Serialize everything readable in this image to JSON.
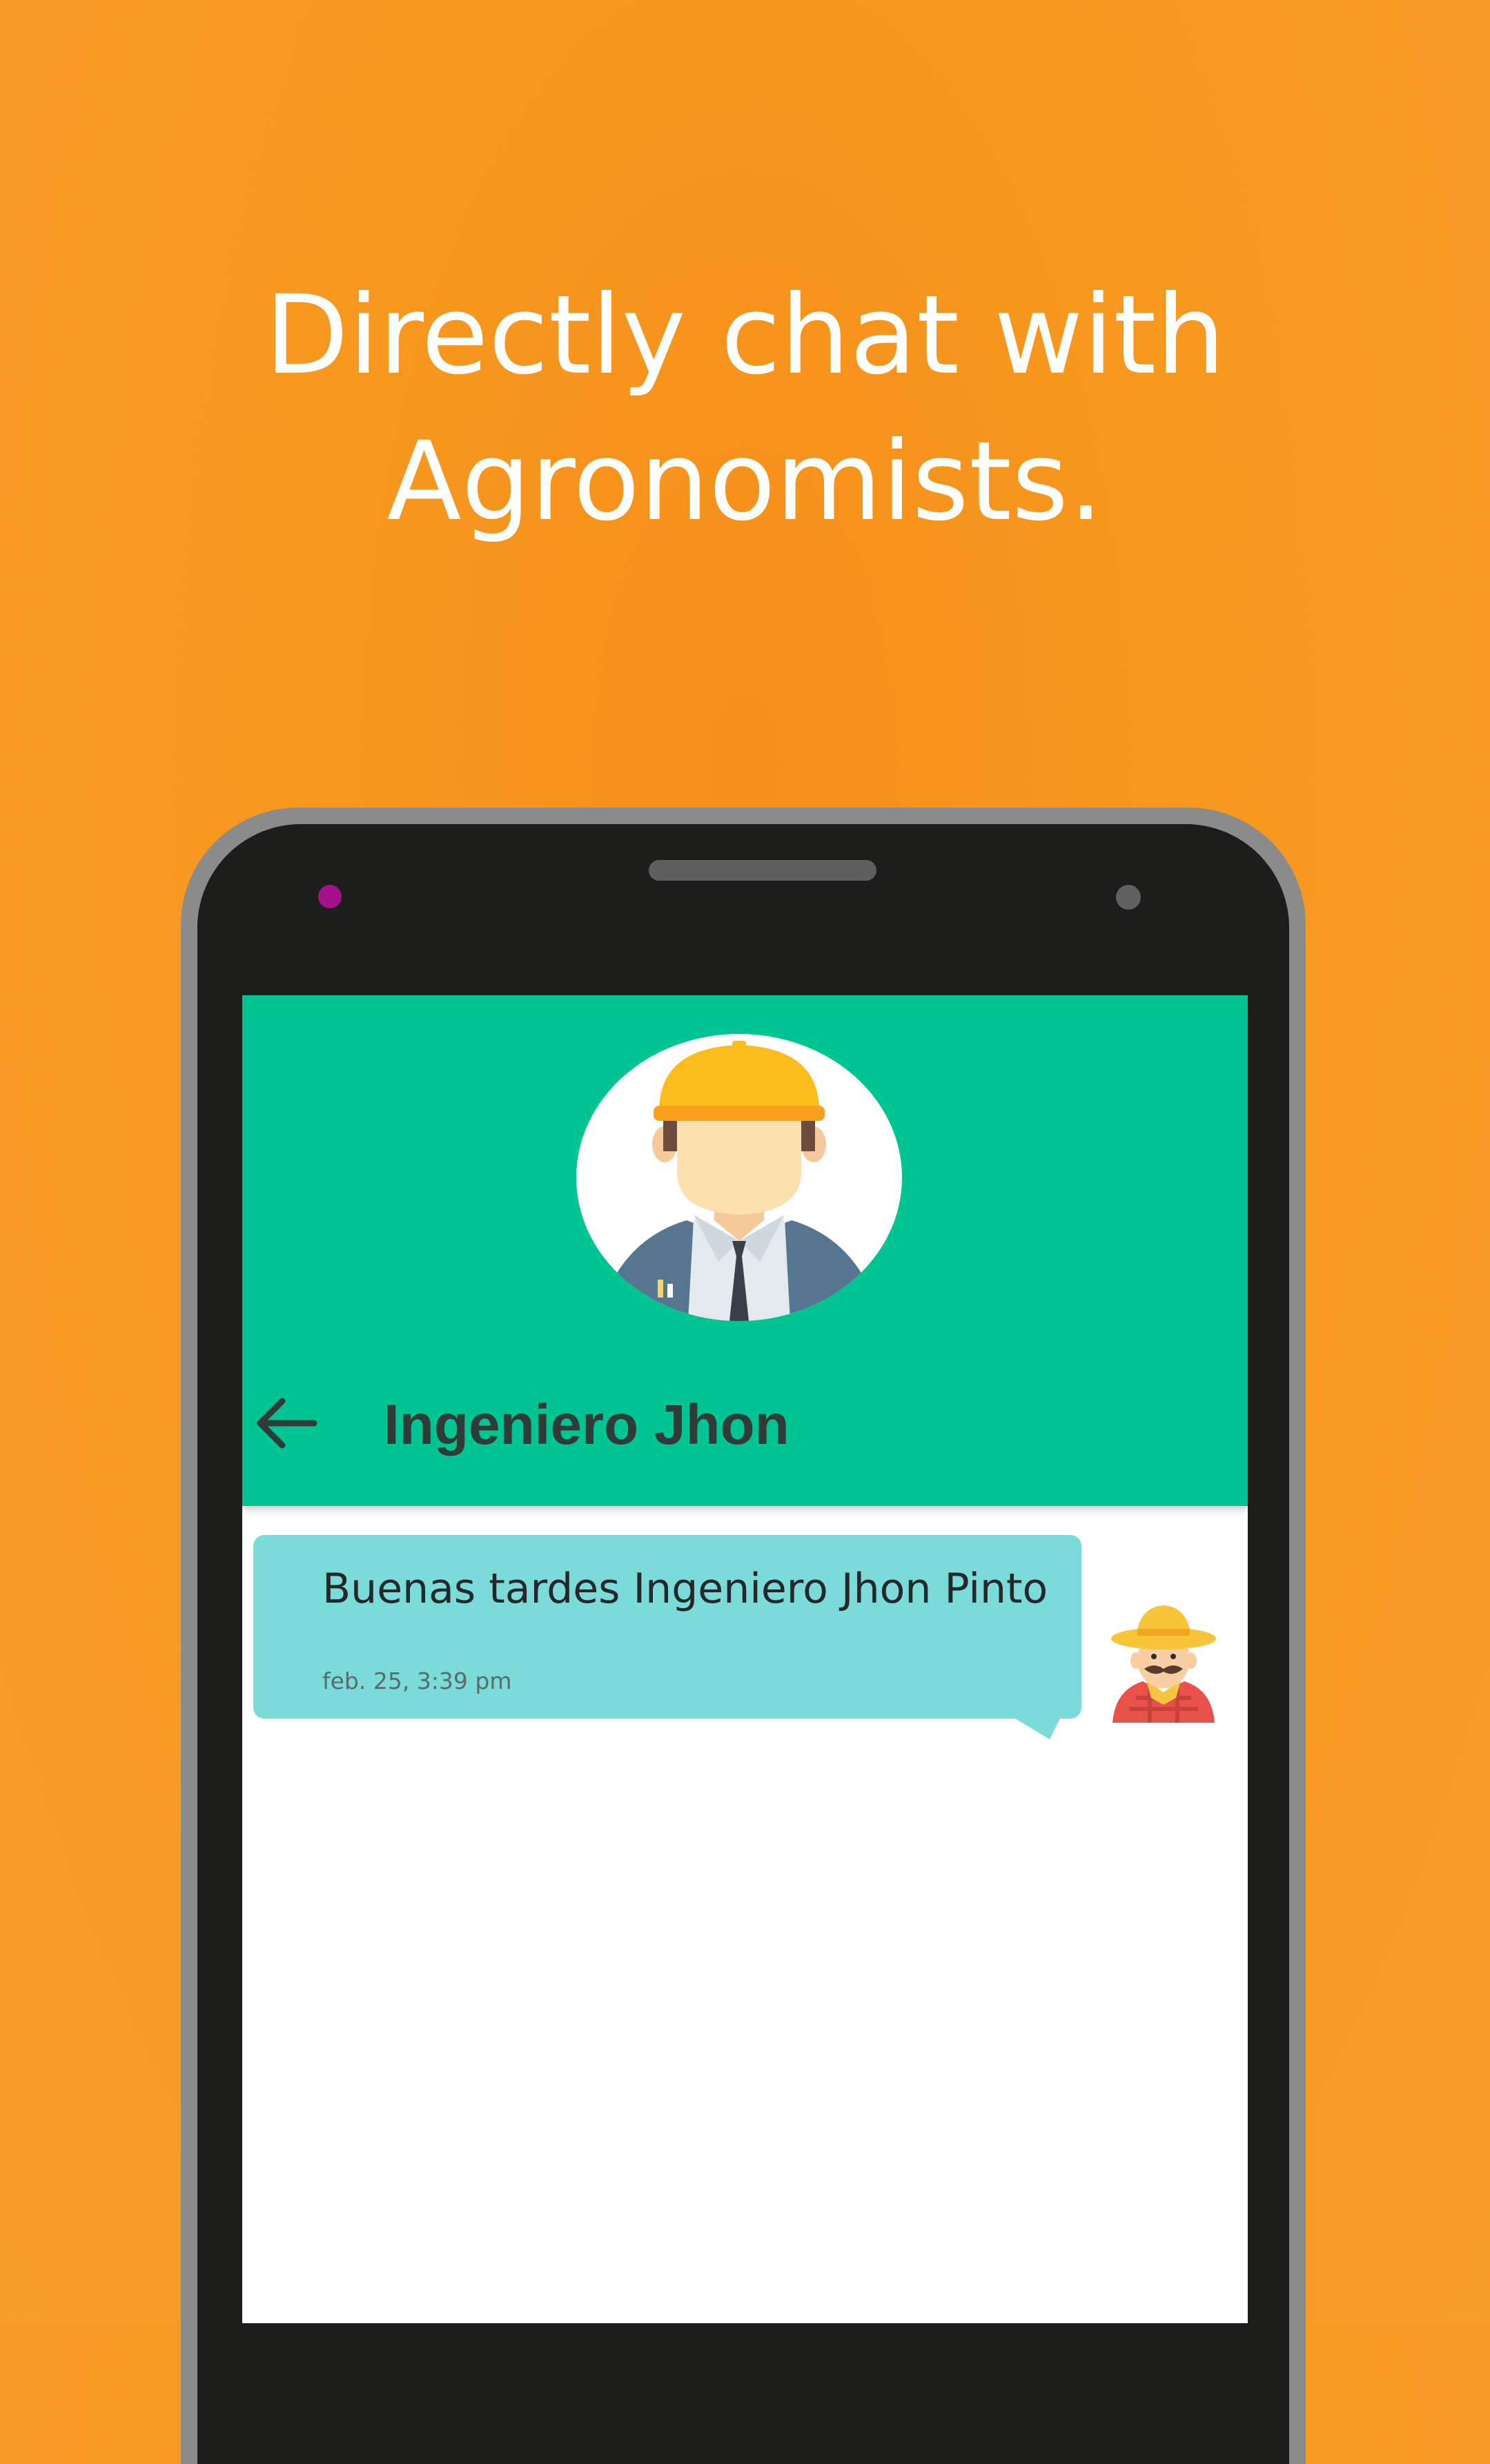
{
  "promo": {
    "headline_line1": "Directly chat with",
    "headline_line2": "Agronomists."
  },
  "colors": {
    "background": "#f89c2a",
    "header": "#00c593",
    "bubble": "#7adbd9",
    "phone_frame": "#1d1d1b"
  },
  "chat": {
    "header": {
      "title": "Ingeniero Jhon",
      "back_icon": "arrow-left-icon",
      "avatar_icon": "engineer-avatar-icon"
    },
    "messages": [
      {
        "text": "Buenas tardes Ingeniero Jhon Pinto",
        "time": "feb. 25, 3:39 pm",
        "avatar_icon": "farmer-avatar-icon"
      }
    ]
  }
}
